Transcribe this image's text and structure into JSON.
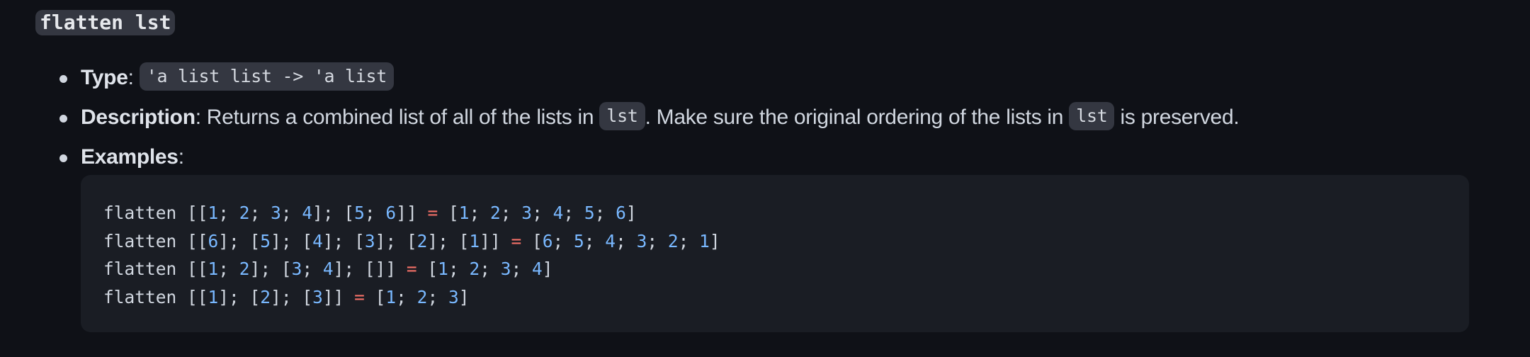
{
  "title": "flatten lst",
  "properties": {
    "type": {
      "label": "Type",
      "colon": ":",
      "value": "'a list list -> 'a list"
    },
    "description": {
      "label": "Description",
      "text_1": ": Returns a combined list of all of the lists in ",
      "code_1": "lst",
      "text_2": ". Make sure the original ordering of the lists in ",
      "code_2": "lst",
      "text_3": " is preserved."
    },
    "examples": {
      "label": "Examples",
      "colon": ":"
    }
  },
  "code_examples": [
    "flatten [[1; 2; 3; 4]; [5; 6]] = [1; 2; 3; 4; 5; 6]",
    "flatten [[6]; [5]; [4]; [3]; [2]; [1]] = [6; 5; 4; 3; 2; 1]",
    "flatten [[1; 2]; [3; 4]; []] = [1; 2; 3; 4]",
    "flatten [[1]; [2]; [3]] = [1; 2; 3]"
  ],
  "colors": {
    "background": "#0f1117",
    "code_background": "#1a1d24",
    "inline_code_background": "#343741",
    "number": "#79b8ff",
    "operator": "#f47067",
    "text": "#d1d7e0"
  }
}
